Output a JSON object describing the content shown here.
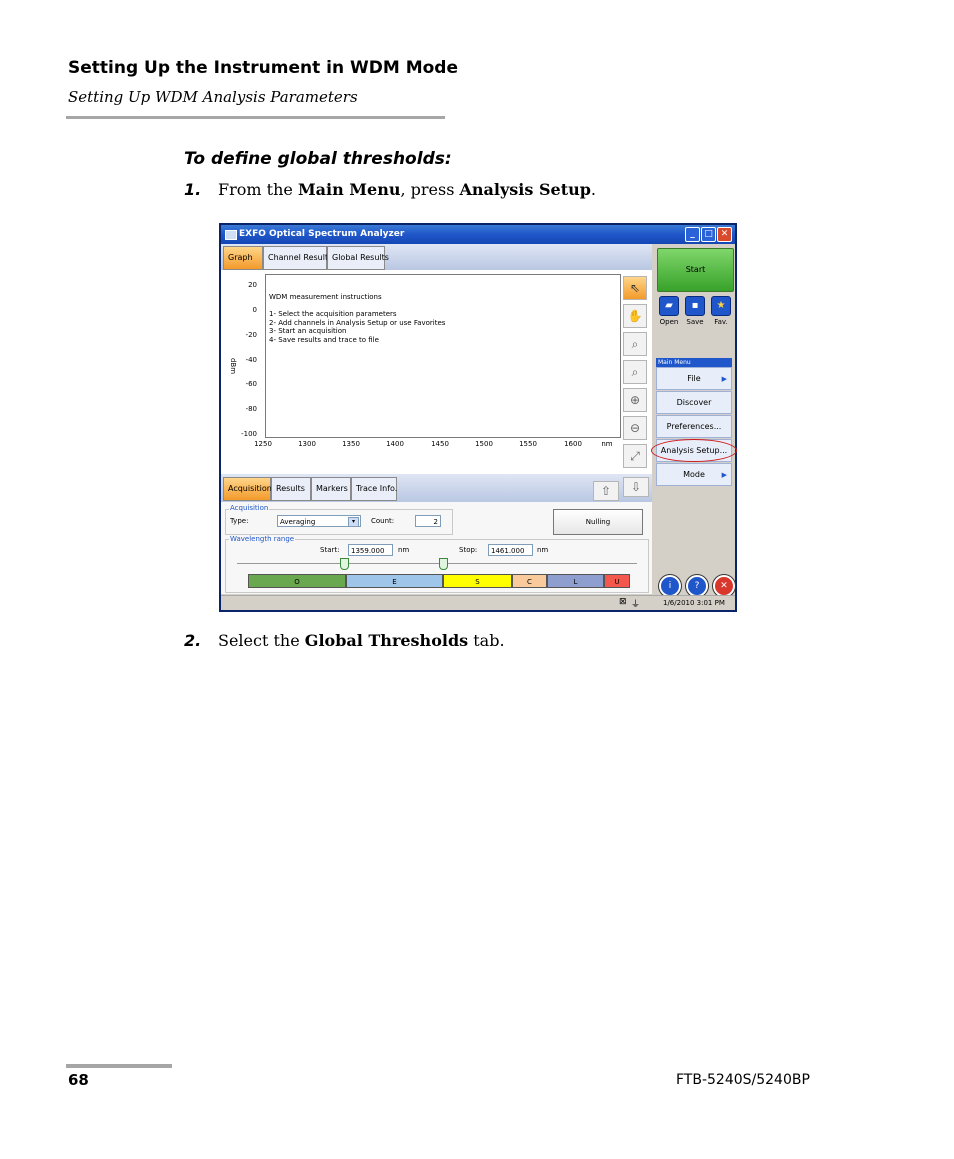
{
  "header": {
    "title": "Setting Up the Instrument in WDM Mode",
    "subtitle": "Setting Up WDM Analysis Parameters"
  },
  "procedure_title": "To define global thresholds:",
  "steps": [
    {
      "num": "1.",
      "pre": "From the ",
      "b1": "Main Menu",
      "mid": ", press ",
      "b2": "Analysis Setup",
      "post": "."
    },
    {
      "num": "2.",
      "pre": "Select the ",
      "b1": "Global Thresholds",
      "post": " tab."
    }
  ],
  "app": {
    "window_title": "EXFO Optical Spectrum Analyzer",
    "top_tabs": [
      "Graph",
      "Channel Results",
      "Global Results"
    ],
    "graph": {
      "instructions_title": "WDM measurement instructions",
      "instructions": [
        "1- Select the acquisition parameters",
        "2- Add channels in Analysis Setup or use Favorites",
        "3- Start an acquisition",
        "4- Save results and trace to file"
      ],
      "y_ticks": [
        "20",
        "0",
        "-20",
        "-40",
        "-60",
        "-80",
        "-100"
      ],
      "x_ticks": [
        "1250",
        "1300",
        "1350",
        "1400",
        "1450",
        "1500",
        "1550",
        "1600"
      ],
      "x_unit": "nm",
      "y_label": "dBm"
    },
    "tool_icons": [
      "pointer-icon",
      "hand-icon",
      "zoom-area-icon",
      "zoom-fit-icon",
      "zoom-in-icon",
      "zoom-out-icon",
      "full-scale-icon"
    ],
    "bottom_tabs": [
      "Acquisition",
      "Results",
      "Markers",
      "Trace Info."
    ],
    "acquisition": {
      "group_label": "Acquisition",
      "type_label": "Type:",
      "type_value": "Averaging",
      "count_label": "Count:",
      "count_value": "2",
      "nulling_button": "Nulling"
    },
    "wavelength": {
      "group_label": "Wavelength range",
      "start_label": "Start:",
      "start_value": "1359.000",
      "stop_label": "Stop:",
      "stop_value": "1461.000",
      "unit": "nm",
      "bands": [
        "O",
        "E",
        "S",
        "C",
        "L",
        "U"
      ],
      "band_colors": [
        "#6aa84f",
        "#9fc5e8",
        "#ffff00",
        "#f9cb9c",
        "#8e9fcf",
        "#f4574b"
      ]
    },
    "side": {
      "start_label": "Start",
      "quick": [
        "Open",
        "Save",
        "Fav."
      ],
      "menu_title": "Main Menu",
      "menu_items": [
        "File",
        "Discover",
        "Preferences...",
        "Analysis Setup...",
        "Mode"
      ]
    },
    "status_time": "1/6/2010 3:01 PM"
  },
  "footer": {
    "page_number": "68",
    "product": "FTB-5240S/5240BP"
  }
}
